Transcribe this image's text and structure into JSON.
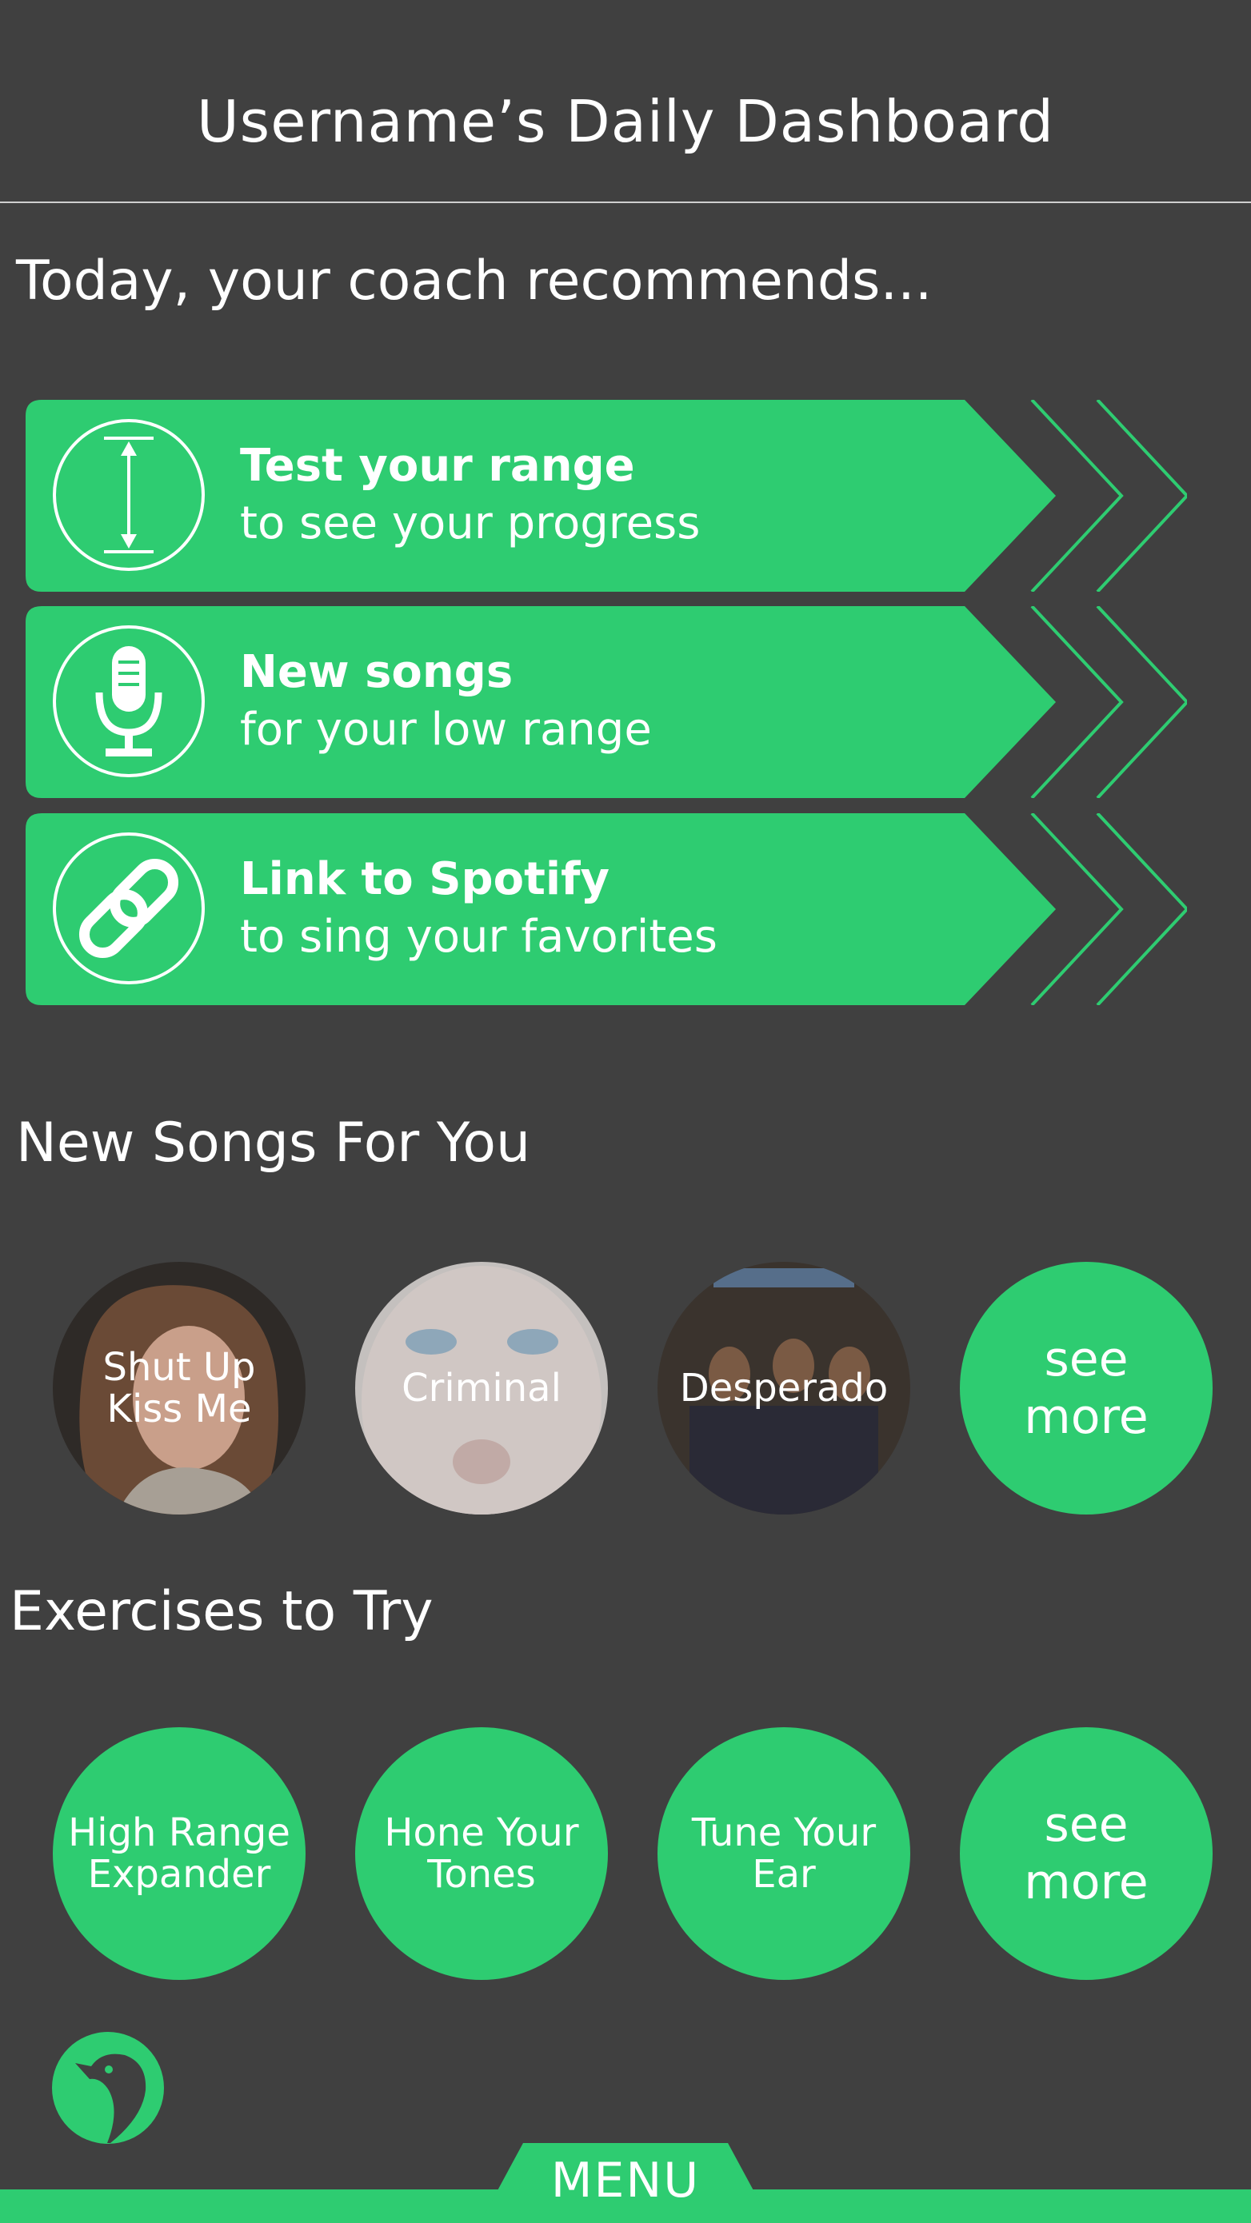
{
  "header": {
    "title": "Username’s Daily Dashboard"
  },
  "recommendations": {
    "heading": "Today, your coach recommends...",
    "items": [
      {
        "title": "Test your range",
        "subtitle": "to see your progress",
        "icon": "range-arrow-icon"
      },
      {
        "title": "New songs",
        "subtitle": "for your low range",
        "icon": "microphone-icon"
      },
      {
        "title": "Link to Spotify",
        "subtitle": "to sing your favorites",
        "icon": "link-icon"
      }
    ]
  },
  "songs": {
    "heading": "New Songs For You",
    "items": [
      {
        "label": "Shut Up\nKiss Me"
      },
      {
        "label": "Criminal"
      },
      {
        "label": "Desperado"
      }
    ],
    "see_more": "see\nmore"
  },
  "exercises": {
    "heading": "Exercises to Try",
    "items": [
      {
        "label": "High Range\nExpander"
      },
      {
        "label": "Hone Your\nTones"
      },
      {
        "label": "Tune Your\nEar"
      }
    ],
    "see_more": "see\nmore"
  },
  "footer": {
    "menu_label": "MENU",
    "logo_icon": "bird-logo-icon"
  },
  "colors": {
    "background": "#404040",
    "accent": "#2ecc71",
    "text": "#ffffff"
  }
}
